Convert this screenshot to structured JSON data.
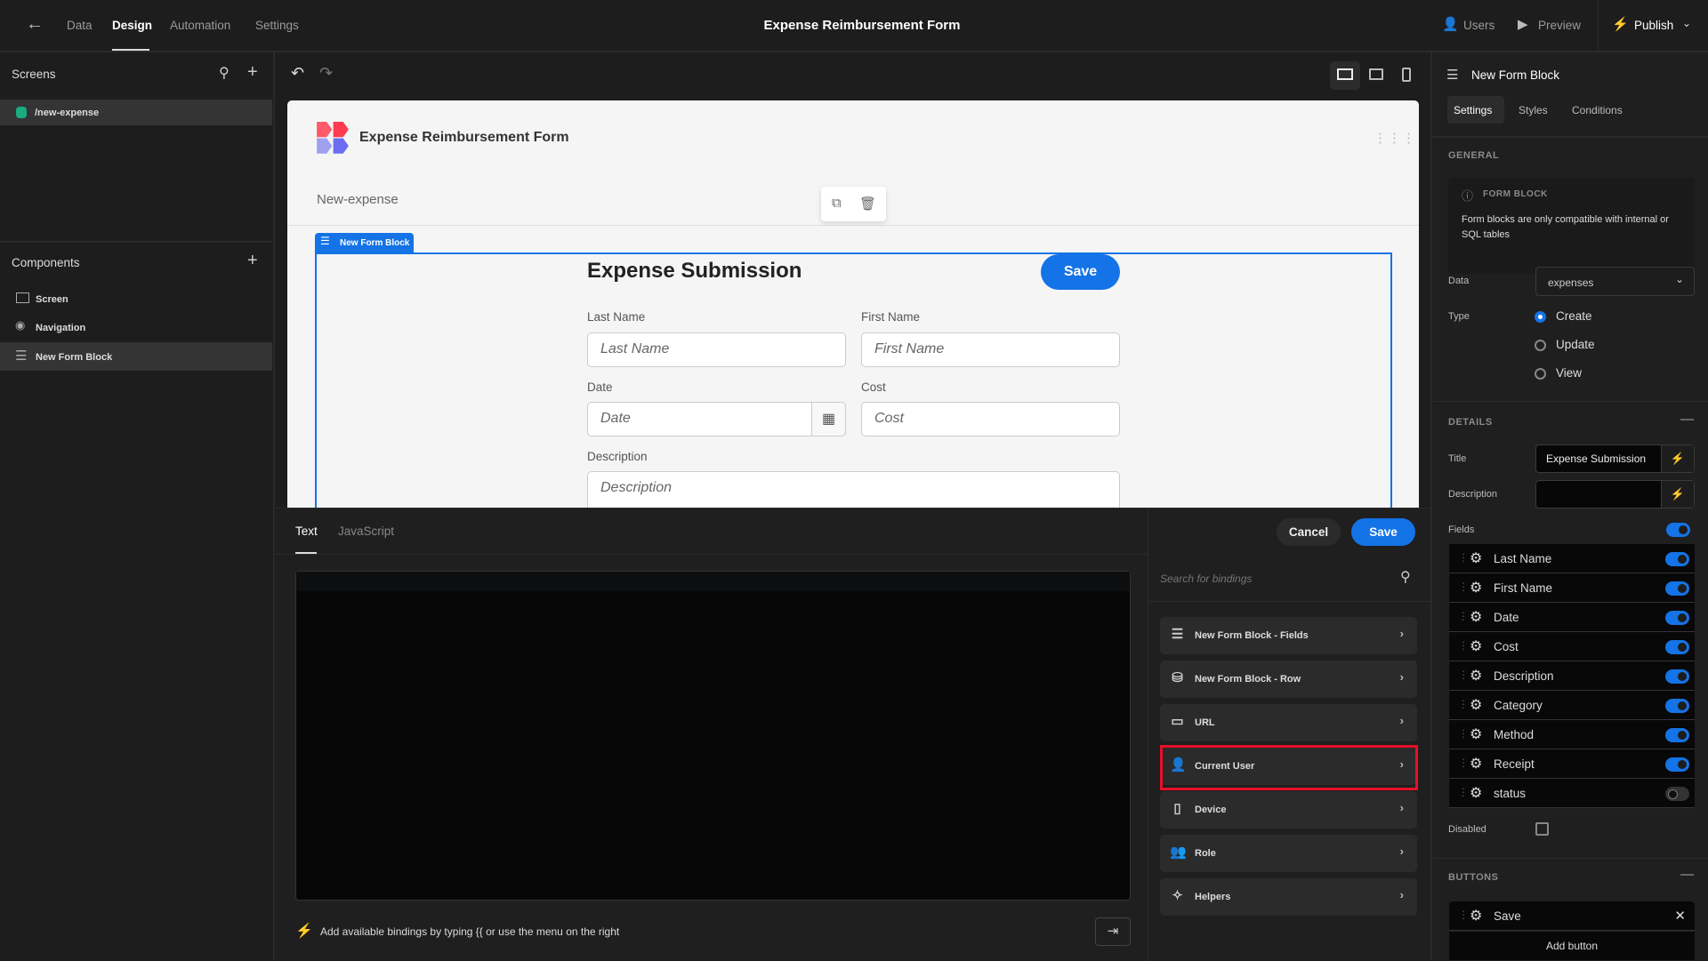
{
  "topbar": {
    "nav": [
      "Data",
      "Design",
      "Automation",
      "Settings"
    ],
    "active": "Design",
    "title": "Expense Reimbursement Form",
    "users": "Users",
    "preview": "Preview",
    "publish": "Publish"
  },
  "sidebar": {
    "screens_title": "Screens",
    "screens": [
      {
        "label": "/new-expense",
        "color": "#1aab7f"
      }
    ],
    "components_title": "Components",
    "components": [
      {
        "label": "Screen",
        "icon": "screen-icon"
      },
      {
        "label": "Navigation",
        "icon": "eye-icon"
      },
      {
        "label": "New Form Block",
        "icon": "form-block-icon"
      }
    ]
  },
  "canvas": {
    "app_title": "Expense Reimbursement Form",
    "screen_name": "New-expense",
    "block_tag": "New Form Block",
    "form_title": "Expense Submission",
    "save": "Save",
    "fields": [
      {
        "label": "Last Name",
        "placeholder": "Last Name"
      },
      {
        "label": "First Name",
        "placeholder": "First Name"
      },
      {
        "label": "Date",
        "placeholder": "Date"
      },
      {
        "label": "Cost",
        "placeholder": "Cost"
      },
      {
        "label": "Description",
        "placeholder": "Description"
      }
    ]
  },
  "binding": {
    "tabs": [
      "Text",
      "JavaScript"
    ],
    "active_tab": "Text",
    "cancel": "Cancel",
    "save": "Save",
    "search_placeholder": "Search for bindings",
    "hint": "Add available bindings by typing {{ or use the menu on the right",
    "items": [
      {
        "label": "New Form Block - Fields",
        "icon": "list-icon"
      },
      {
        "label": "New Form Block - Row",
        "icon": "database-icon"
      },
      {
        "label": "URL",
        "icon": "browser-icon"
      },
      {
        "label": "Current User",
        "icon": "user-icon",
        "highlighted": true
      },
      {
        "label": "Device",
        "icon": "device-icon"
      },
      {
        "label": "Role",
        "icon": "role-icon"
      },
      {
        "label": "Helpers",
        "icon": "magic-wand-icon"
      }
    ]
  },
  "panel": {
    "title": "New Form Block",
    "tabs": [
      "Settings",
      "Styles",
      "Conditions"
    ],
    "active_tab": "Settings",
    "general": "GENERAL",
    "info_title": "FORM BLOCK",
    "info_text": "Form blocks are only compatible with internal or SQL tables",
    "data_label": "Data",
    "data_value": "expenses",
    "type_label": "Type",
    "types": [
      {
        "label": "Create",
        "selected": true
      },
      {
        "label": "Update",
        "selected": false
      },
      {
        "label": "View",
        "selected": false
      }
    ],
    "details": "DETAILS",
    "title_label": "Title",
    "title_value": "Expense Submission",
    "description_label": "Description",
    "description_value": "",
    "fields_label": "Fields",
    "fields_enabled": true,
    "fields": [
      {
        "name": "Last Name",
        "on": true
      },
      {
        "name": "First Name",
        "on": true
      },
      {
        "name": "Date",
        "on": true
      },
      {
        "name": "Cost",
        "on": true
      },
      {
        "name": "Description",
        "on": true
      },
      {
        "name": "Category",
        "on": true
      },
      {
        "name": "Method",
        "on": true
      },
      {
        "name": "Receipt",
        "on": true
      },
      {
        "name": "status",
        "on": false
      }
    ],
    "disabled_label": "Disabled",
    "disabled": false,
    "buttons": "BUTTONS",
    "button_items": [
      "Save"
    ],
    "add_button": "Add button"
  },
  "colors": {
    "accent": "#1473e6",
    "highlight": "#e8102a"
  }
}
